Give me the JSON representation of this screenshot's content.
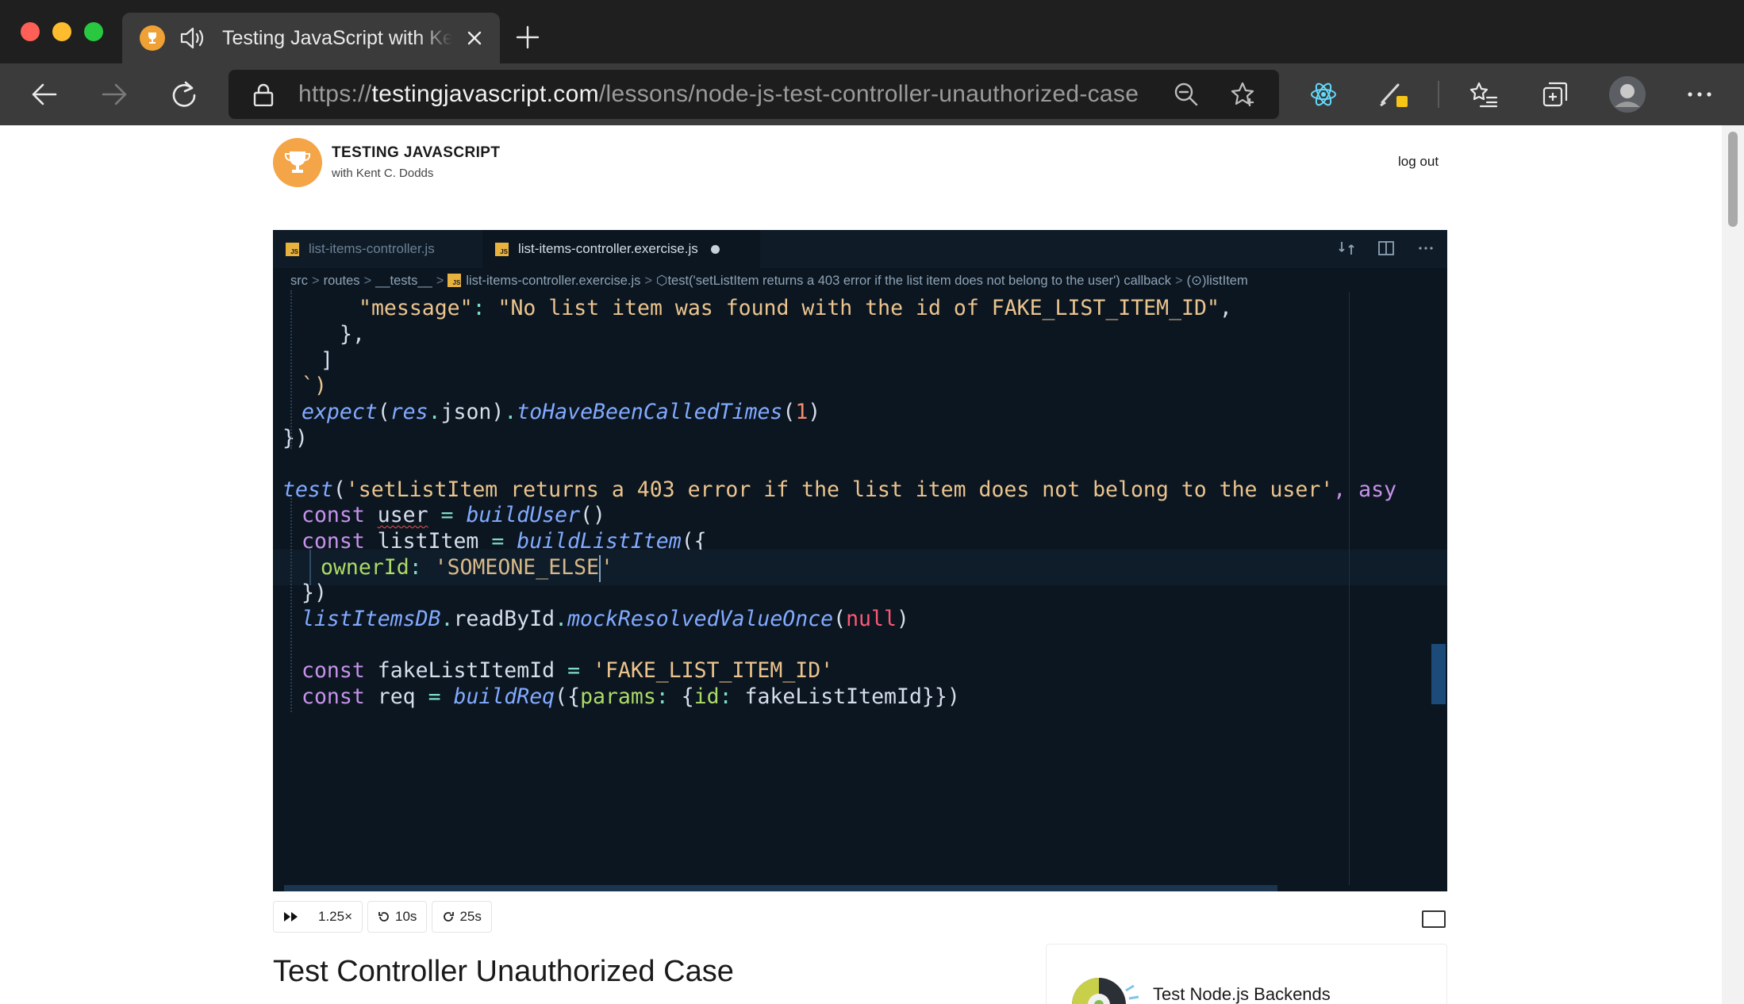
{
  "browser": {
    "tab_title": "Testing JavaScript with Kent C. Dodds",
    "url_scheme": "https://",
    "url_host": "testingjavascript.com",
    "url_path": "/lessons/node-js-test-controller-unauthorized-case"
  },
  "site": {
    "brand_title": "TESTING JAVASCRIPT",
    "brand_sub": "with Kent C. Dodds",
    "logout": "log out"
  },
  "editor": {
    "tabs": [
      {
        "label": "list-items-controller.js"
      },
      {
        "label": "list-items-controller.exercise.js"
      }
    ],
    "breadcrumb": [
      "src",
      "routes",
      "__tests__",
      "list-items-controller.exercise.js",
      "test('setListItem returns a 403 error if the list item does not belong to the user') callback",
      "listItem"
    ],
    "code": {
      "l1_str": "\"message\"",
      "l1_colon": ": ",
      "l1_val": "\"No list item was found with the id of FAKE_LIST_ITEM_ID\"",
      "l1_comma": ",",
      "l2": "},",
      "l3": "]",
      "l4": "`)",
      "l5_fn": "expect",
      "l5_arg": "res",
      "l5_prop": "json",
      "l5_method": "toHaveBeenCalledTimes",
      "l5_num": "1",
      "l6": "})",
      "l8_fn": "test",
      "l8_str": "'setListItem returns a 403 error if the list item does not belong to the user'",
      "l8_tail": ", asy",
      "l9_kw": "const",
      "l9_var": "user",
      "l9_fn": "buildUser",
      "l10_kw": "const",
      "l10_var": "listItem",
      "l10_fn": "buildListItem",
      "l11_prop": "ownerId",
      "l11_str": "'SOMEONE_ELSE",
      "l11_q": "'",
      "l12": "})",
      "l13_obj": "listItemsDB",
      "l13_m1": "readById",
      "l13_m2": "mockResolvedValueOnce",
      "l13_null": "null",
      "l15_kw": "const",
      "l15_var": "fakeListItemId",
      "l15_str": "'FAKE_LIST_ITEM_ID'",
      "l16_kw": "const",
      "l16_var": "req",
      "l16_fn": "buildReq",
      "l16_k1": "params",
      "l16_k2": "id",
      "l16_v": "fakeListItemId"
    }
  },
  "player": {
    "speed": "1.25×",
    "back": "10s",
    "forward": "25s"
  },
  "lesson": {
    "title": "Test Controller Unauthorized Case"
  },
  "course": {
    "title": "Test Node.js Backends"
  },
  "colors": {
    "editor_bg": "#0b1621",
    "accent": "#f3a547"
  }
}
